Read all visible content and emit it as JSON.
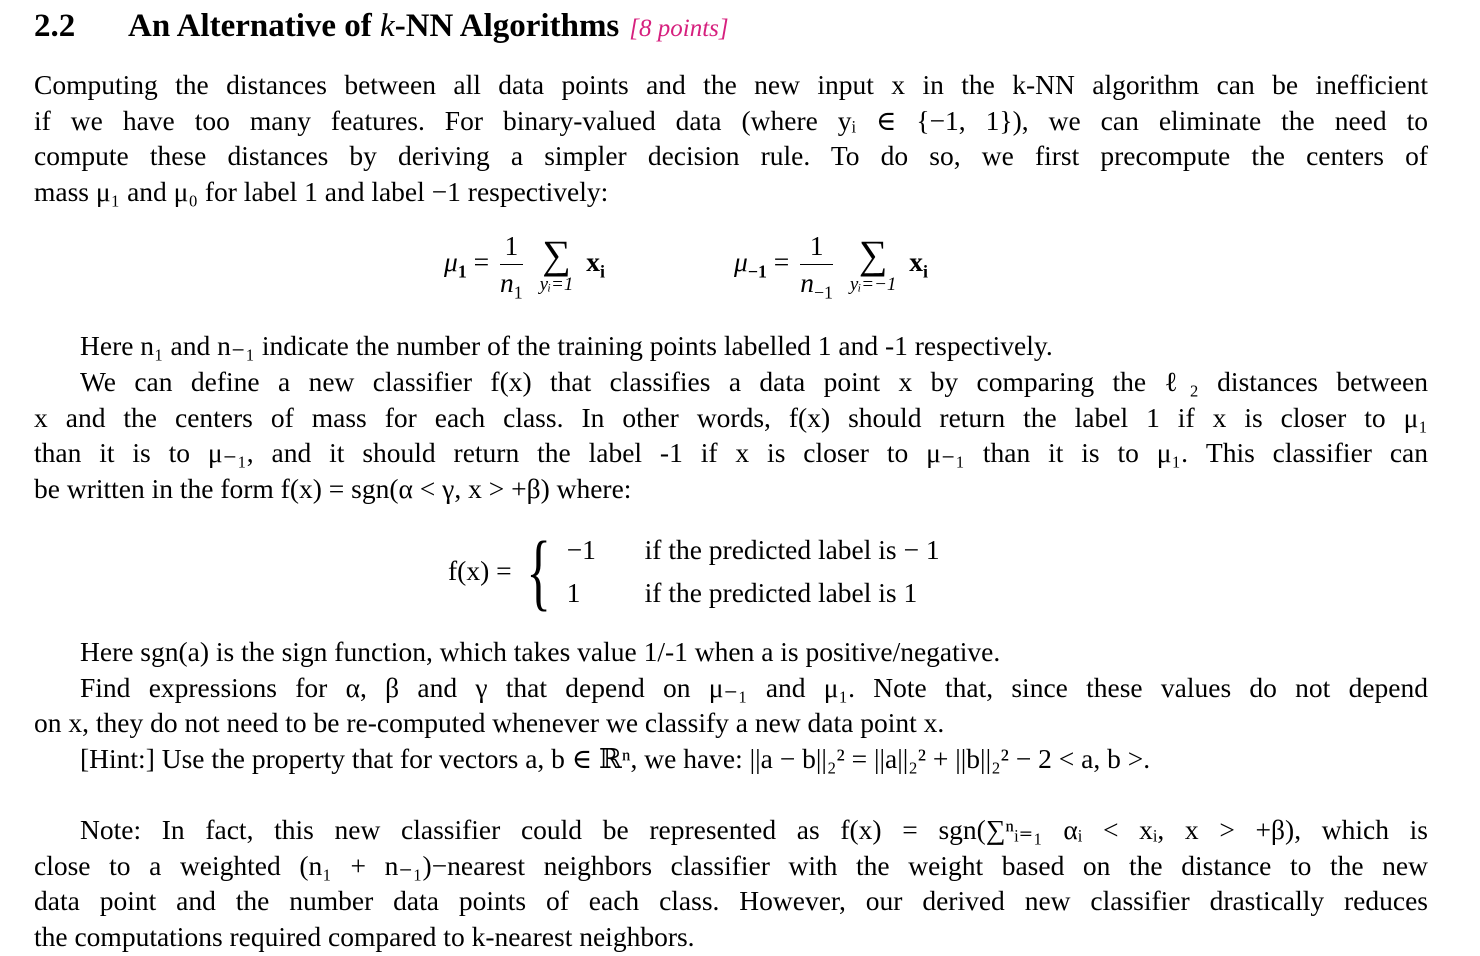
{
  "section": {
    "number": "2.2",
    "title_pre": "An Alternative of ",
    "title_k": "k",
    "title_post": "-NN Algorithms",
    "points": "[8 points]",
    "points_color": "#d6207e"
  },
  "intro": [
    "Computing the distances between all data points and the new input x in the k-NN algorithm can be inefficient",
    "if we have too many features. For binary-valued data (where yᵢ ∈ {−1, 1}), we can eliminate the need to",
    "compute these distances by deriving a simpler decision rule. To do so, we first precompute the centers of",
    "mass μ₁ and μ₀ for label 1 and label −1 respectively:"
  ],
  "equations": {
    "mu1_lhs": "μ",
    "mu1_sub": "1",
    "eq": "=",
    "num": "1",
    "mu1_den": "n",
    "mu1_den_sub": "1",
    "sigma": "∑",
    "mu1_lim": "yᵢ=1",
    "xi": "x",
    "xi_sub": "i",
    "mum1_sub": "−1",
    "mum1_den_sub": "−1",
    "mum1_lim": "yᵢ=−1"
  },
  "para2": [
    "Here n₁ and n₋₁ indicate the number of the training points labelled 1 and -1 respectively."
  ],
  "para3": [
    "We can define a new classifier f(x) that classifies a data point x by comparing the ℓ₂ distances between",
    "x and the centers of mass for each class. In other words, f(x) should return the label 1 if x is closer to μ₁",
    "than it is to μ₋₁, and it should return the label -1 if x is closer to μ₋₁ than it is to μ₁. This classifier can",
    "be written in the form f(x) = sgn(α < γ, x > +β) where:"
  ],
  "cases": {
    "lhs": "f(x) =",
    "row1_val": "−1",
    "row1_cond": "if the predicted label is  − 1",
    "row2_val": "1",
    "row2_cond": "if the predicted label is 1"
  },
  "para4": [
    "Here sgn(a) is the sign function, which takes value 1/-1 when a is positive/negative.",
    "Find expressions for α, β and γ that depend on μ₋₁ and μ₁. Note that, since these values do not depend",
    "on x, they do not need to be re-computed whenever we classify a new data point x.",
    "[Hint:] Use the property that for vectors a, b ∈ ℝⁿ, we have: ||a − b||₂² = ||a||₂² + ||b||₂² − 2 < a, b >."
  ],
  "note": [
    "Note: In fact, this new classifier could be represented as f(x) = sgn(∑ⁿᵢ₌₁ αᵢ < xᵢ, x > +β), which is",
    "close to a weighted (n₁ + n₋₁)−nearest neighbors classifier with the weight based on the distance to the new",
    "data point and the number data points of each class. However, our derived new classifier drastically reduces",
    "the computations required compared to k-nearest neighbors."
  ]
}
